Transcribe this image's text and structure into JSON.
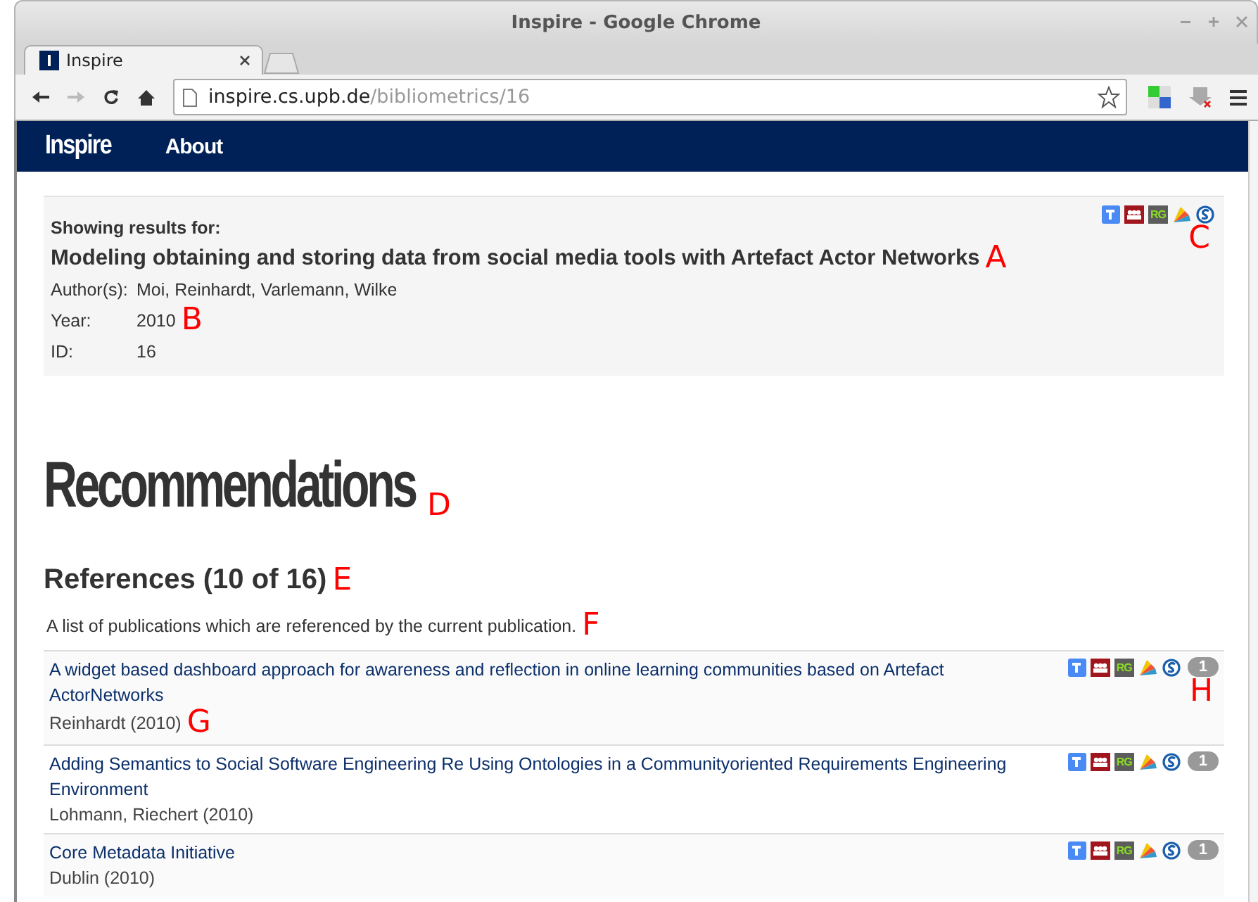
{
  "window": {
    "title": "Inspire - Google Chrome"
  },
  "tabs": [
    {
      "label": "Inspire",
      "selected": true
    }
  ],
  "address_bar": {
    "host": "inspire.cs.upb.de",
    "path": "/bibliometrics/16"
  },
  "navbar": {
    "brand": "Inspire",
    "links": [
      "About"
    ]
  },
  "query": {
    "heading": "Showing results for:",
    "title": "Modeling obtaining and storing data from social media tools with Artefact Actor Networks",
    "title_marker": "A",
    "rg_label": "RG",
    "icons_marker": "C",
    "fields": [
      {
        "label": "Author(s):",
        "value": "Moi, Reinhardt, Varlemann, Wilke"
      },
      {
        "label": "Year:",
        "value": "2010",
        "marker": "B"
      },
      {
        "label": "ID:",
        "value": "16"
      }
    ]
  },
  "page_heading": {
    "text": "Recommendations",
    "marker": "D"
  },
  "references": {
    "heading": "References (10 of 16)",
    "heading_marker": "E",
    "description": "A list of publications which are referenced by the current publication.",
    "description_marker": "F",
    "items": [
      {
        "title": "A widget based dashboard approach for awareness and reflection in online learning communities based on Artefact ActorNetworks",
        "authors": "Reinhardt (2010)",
        "authors_marker": "G",
        "rg_label": "RG",
        "count": "1",
        "count_marker": "H"
      },
      {
        "title": "Adding Semantics to Social Software Engineering Re Using Ontologies in a Communityoriented Requirements Engineering Environment",
        "authors": "Lohmann, Riechert (2010)",
        "rg_label": "RG",
        "count": "1"
      },
      {
        "title": "Core Metadata Initiative",
        "authors": "Dublin (2010)",
        "rg_label": "RG",
        "count": "1"
      }
    ]
  }
}
